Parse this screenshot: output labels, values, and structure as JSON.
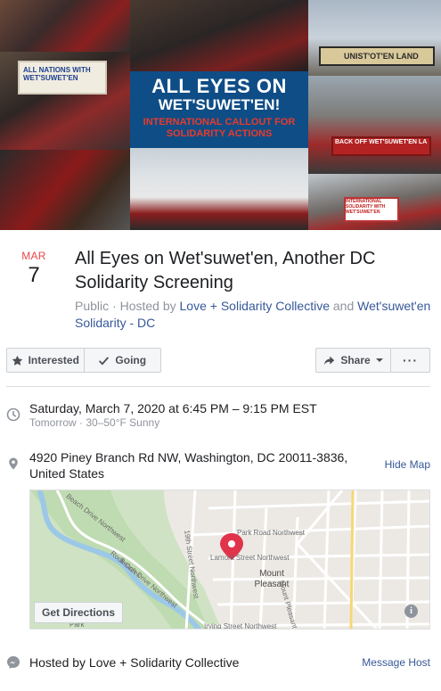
{
  "cover": {
    "headline_line1": "ALL EYES ON",
    "headline_line2": "WET'SUWET'EN!",
    "headline_line3": "INTERNATIONAL CALLOUT FOR SOLIDARITY ACTIONS",
    "sign_top_right": "UNIST'OT'EN LAND",
    "sign_mid_right": "BACK OFF WET'SUWET'EN LA",
    "sign_left": "ALL NATIONS WITH WET'SUWET'EN",
    "sign_bottom_right": "INTERNATIONAL SOLIDARITY WITH WET'SUWET'EN"
  },
  "event": {
    "month": "MAR",
    "day": "7",
    "title": "All Eyes on Wet'suwet'en, Another DC Solidarity Screening",
    "privacy": "Public",
    "hosted_by_prefix": "· Hosted by",
    "host1": "Love + Solidarity Collective",
    "and": "and",
    "host2": "Wet'suwet'en Solidarity - DC"
  },
  "actions": {
    "interested": "Interested",
    "going": "Going",
    "share": "Share",
    "more": "···"
  },
  "details": {
    "datetime": "Saturday, March 7, 2020 at 6:45 PM – 9:15 PM EST",
    "weather": "Tomorrow · 30–50°F Sunny",
    "address": "4920 Piney Branch Rd NW, Washington, DC 20011-3836, United States",
    "hide_map": "Hide Map"
  },
  "map": {
    "labels": {
      "park_road": "Park Road Northwest",
      "lamont": "Lamont Street Northwest",
      "mount_pleasant": "Mount Pleasant",
      "mount_pleasant_st": "Mount Pleasant Street",
      "nineteenth": "19th Street Northwest",
      "beach_drive": "Beach Drive Northwest",
      "beach_drive_2": "Beach Drive Northwest",
      "rock_creek": "Rock Creek",
      "irving": "Irving Street Northwest",
      "park": "Park"
    },
    "get_directions": "Get Directions",
    "info": "i"
  },
  "host_row": {
    "text": "Hosted by Love + Solidarity Collective",
    "message": "Message Host"
  },
  "colors": {
    "link": "#365899",
    "month": "#e9474b",
    "pin": "#e0344b",
    "cover_blue": "#0f4d86"
  }
}
